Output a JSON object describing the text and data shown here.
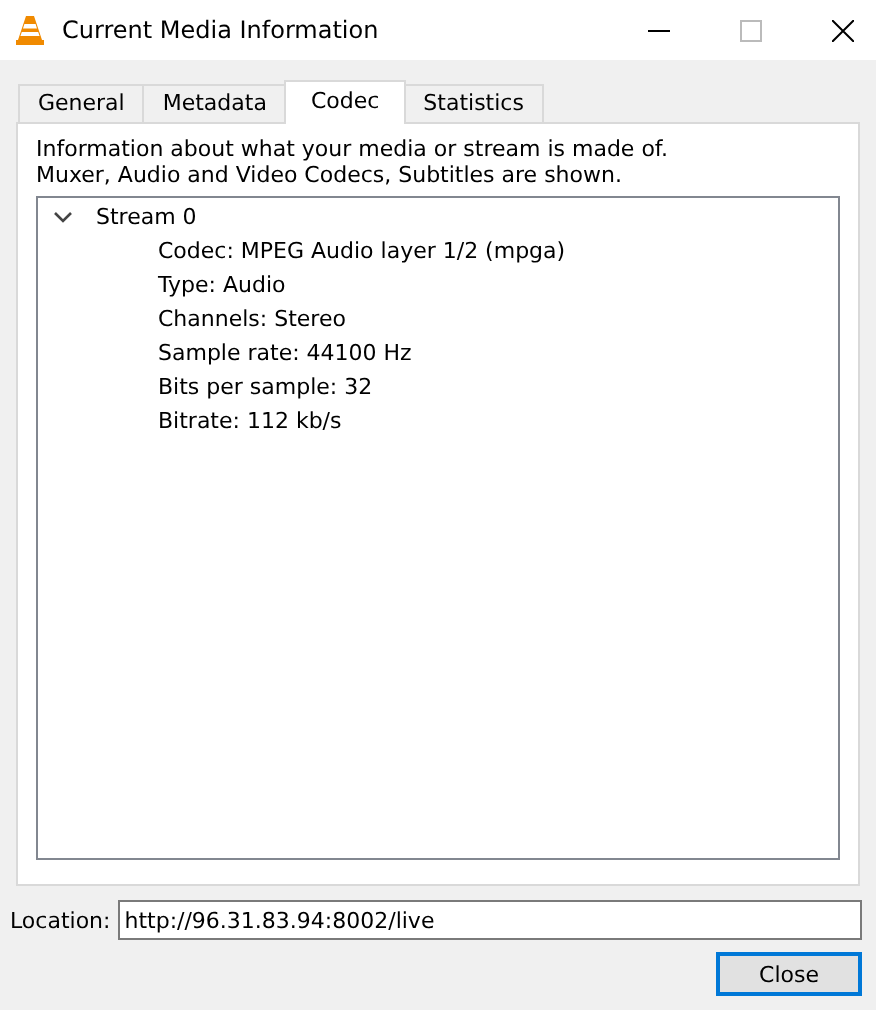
{
  "window": {
    "title": "Current Media Information"
  },
  "tabs": [
    {
      "label": "General",
      "selected": false
    },
    {
      "label": "Metadata",
      "selected": false
    },
    {
      "label": "Codec",
      "selected": true
    },
    {
      "label": "Statistics",
      "selected": false
    }
  ],
  "description": [
    "Information about what your media or stream is made of.",
    "Muxer, Audio and Video Codecs, Subtitles are shown."
  ],
  "tree": [
    {
      "label": "Stream 0",
      "expanded": true,
      "children": [
        {
          "label": "Codec: MPEG Audio layer 1/2 (mpga)"
        },
        {
          "label": "Type: Audio"
        },
        {
          "label": "Channels: Stereo"
        },
        {
          "label": "Sample rate: 44100 Hz"
        },
        {
          "label": "Bits per sample: 32"
        },
        {
          "label": "Bitrate: 112 kb/s"
        }
      ]
    }
  ],
  "location": {
    "label": "Location:",
    "value": "http://96.31.83.94:8002/live"
  },
  "buttons": [
    "Close"
  ]
}
